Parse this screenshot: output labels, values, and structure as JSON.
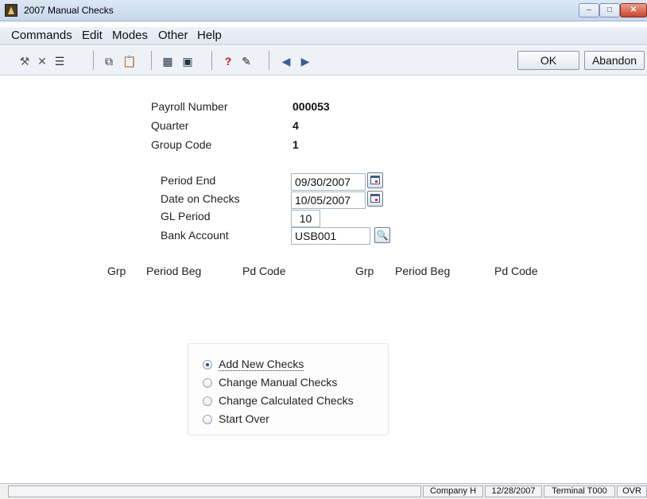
{
  "window": {
    "title": "2007  Manual Checks"
  },
  "menu": {
    "items": [
      "Commands",
      "Edit",
      "Modes",
      "Other",
      "Help"
    ]
  },
  "toolbar": {
    "ok_label": "OK",
    "abandon_label": "Abandon"
  },
  "form": {
    "payroll_number_label": "Payroll Number",
    "payroll_number": "000053",
    "quarter_label": "Quarter",
    "quarter": "4",
    "group_code_label": "Group Code",
    "group_code": "1",
    "period_end_label": "Period End",
    "period_end": "09/30/2007",
    "date_on_checks_label": "Date on Checks",
    "date_on_checks": "10/05/2007",
    "gl_period_label": "GL Period",
    "gl_period": "10",
    "bank_account_label": "Bank Account",
    "bank_account": "USB001"
  },
  "columns": {
    "left": [
      "Grp",
      "Period Beg",
      "Pd Code"
    ],
    "right": [
      "Grp",
      "Period Beg",
      "Pd Code"
    ]
  },
  "options": {
    "selected": "Add New Checks",
    "items": [
      "Add New Checks",
      "Change Manual Checks",
      "Change Calculated Checks",
      "Start Over"
    ]
  },
  "status": {
    "company": "Company H",
    "date": "12/28/2007",
    "terminal": "Terminal T000",
    "mode": "OVR"
  }
}
